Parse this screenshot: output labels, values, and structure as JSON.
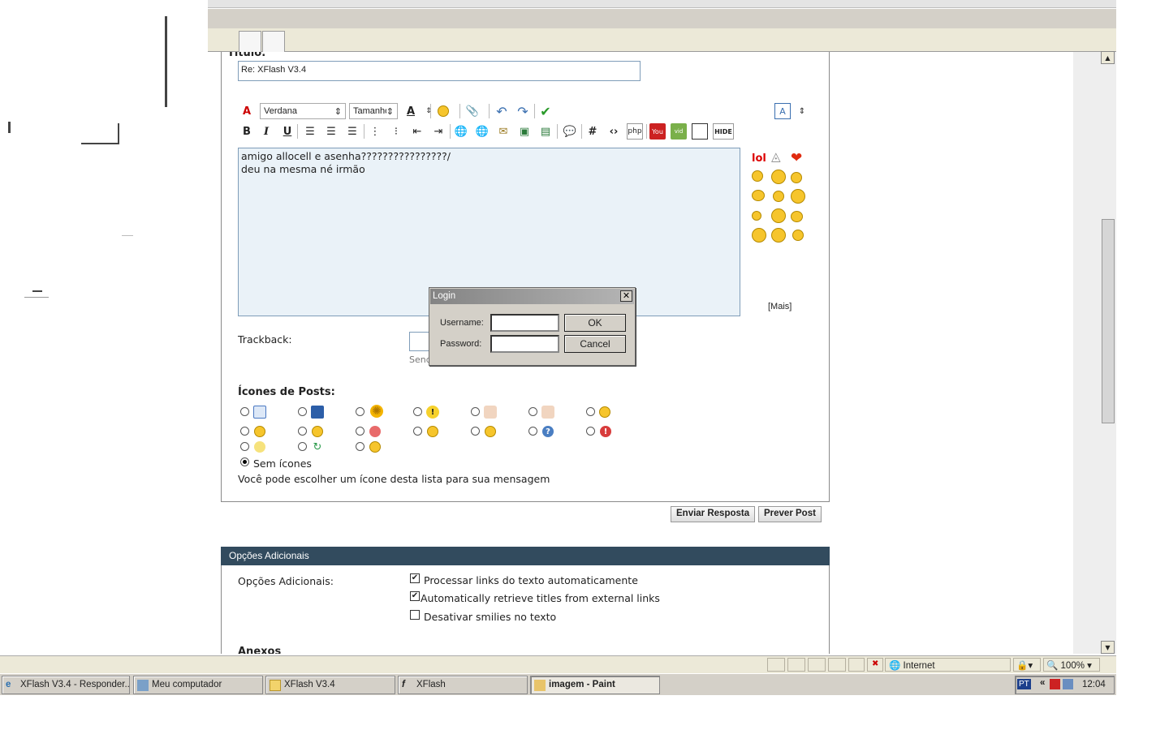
{
  "form": {
    "title_label": "Título:",
    "title_value": "Re: XFlash V3.4",
    "font_select": "Verdana",
    "size_select": "Tamanho",
    "editor_lines": [
      "amigo allocell e asenha????????????????/",
      "deu na mesma né irmão"
    ],
    "smilies_lol": "lol",
    "smilies_more": "[Mais]",
    "trackback_label": "Trackback:",
    "trackback_hint": "Send",
    "post_icons_heading": "Ícones de Posts:",
    "no_icon_label": "Sem ícones",
    "post_icons_hint": "Você pode escolher um ícone desta lista para sua mensagem",
    "submit_label": "Enviar Resposta",
    "preview_label": "Prever Post",
    "hide_label": "HIDE"
  },
  "options": {
    "header": "Opções Adicionais",
    "label": "Opções Adicionais:",
    "items": [
      {
        "label": "Processar links do texto automaticamente",
        "checked": true
      },
      {
        "label": "Automatically retrieve titles from external links",
        "checked": true
      },
      {
        "label": "Desativar smilies no texto",
        "checked": false
      }
    ],
    "attachments_heading": "Anexos"
  },
  "login_dialog": {
    "title": "Login",
    "username_label": "Username:",
    "password_label": "Password:",
    "ok_label": "OK",
    "cancel_label": "Cancel",
    "close_glyph": "✕"
  },
  "statusbar": {
    "zone": "Internet",
    "zoom": "100%"
  },
  "taskbar": {
    "tasks": [
      {
        "label": "XFlash V3.4 - Responder..."
      },
      {
        "label": "Meu computador"
      },
      {
        "label": "XFlash V3.4"
      },
      {
        "label": "XFlash"
      },
      {
        "label": "imagem - Paint"
      }
    ],
    "lang": "PT",
    "clock": "12:04"
  },
  "colors": {
    "editor_bg": "#eaf2f8",
    "options_header_bg": "#324b5e",
    "dialog_bg": "#d4d0c8"
  }
}
